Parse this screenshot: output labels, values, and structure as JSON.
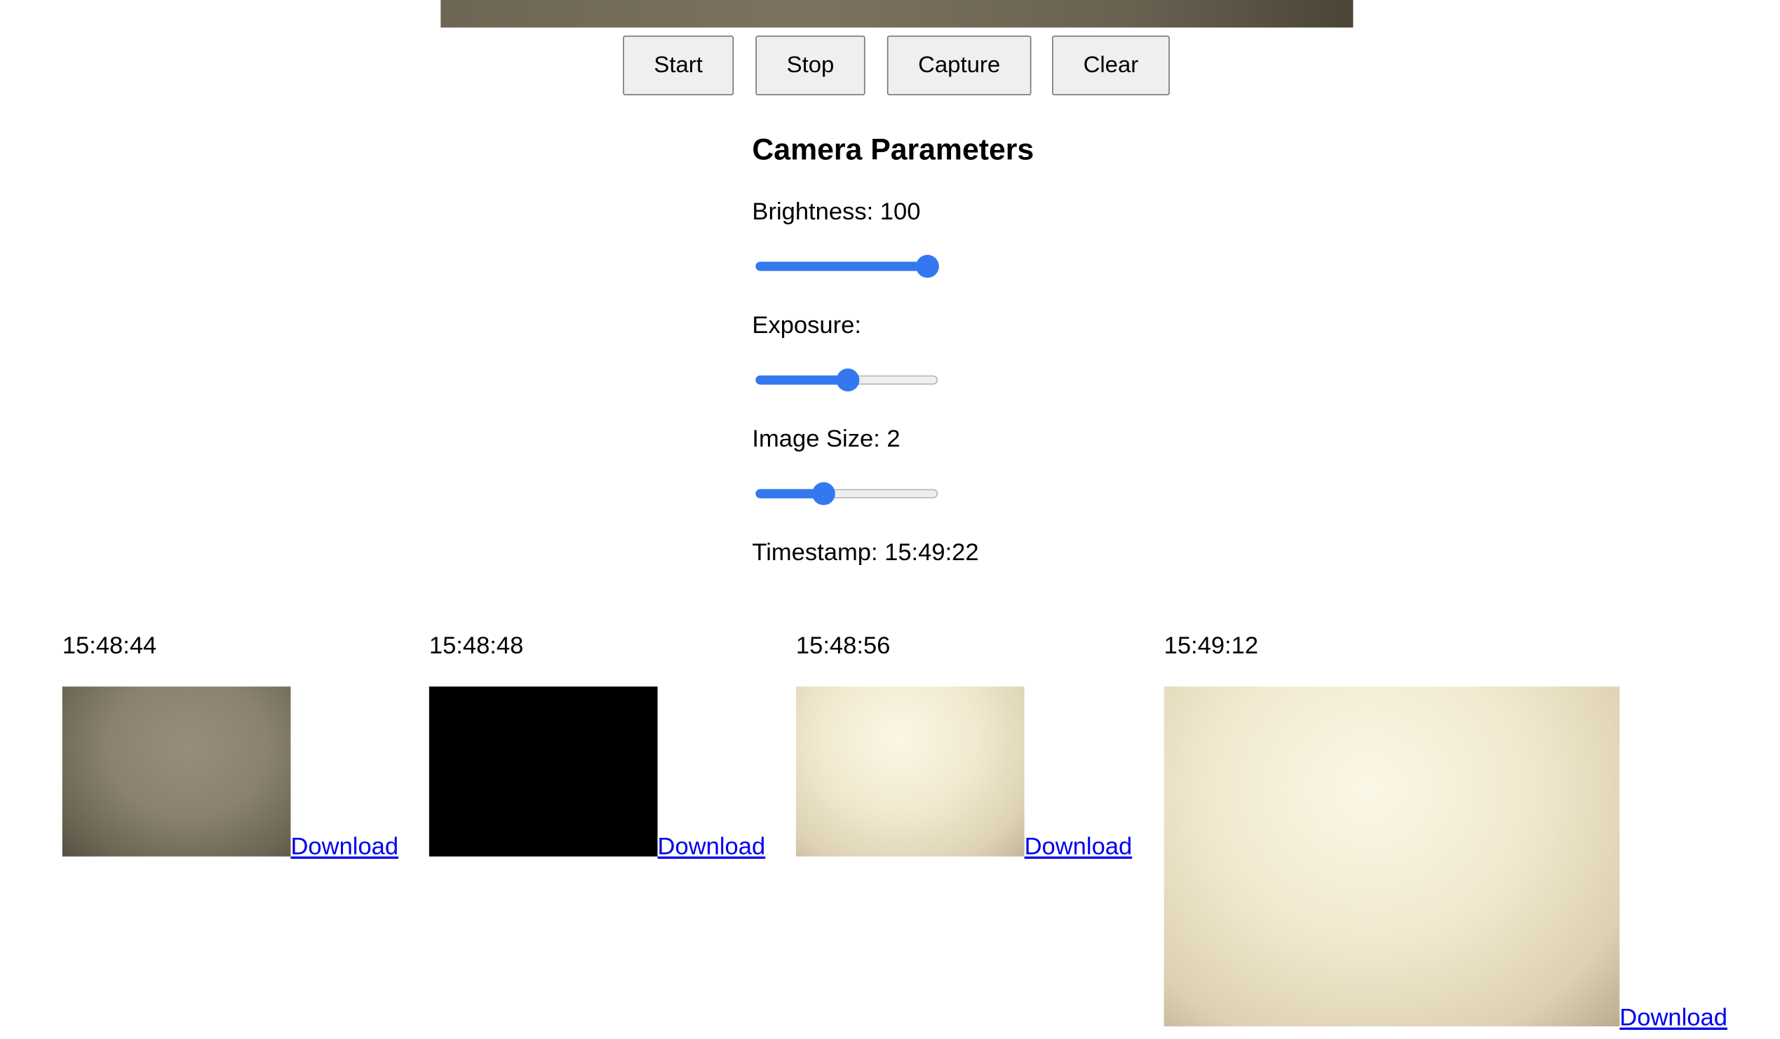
{
  "controls": {
    "start_label": "Start",
    "stop_label": "Stop",
    "capture_label": "Capture",
    "clear_label": "Clear"
  },
  "parameters": {
    "heading": "Camera Parameters",
    "brightness_label": "Brightness: 100",
    "brightness_level": 1.0,
    "exposure_label": "Exposure:",
    "exposure_level": 0.5,
    "image_size_label": "Image Size: 2",
    "image_size_level": 0.35,
    "timestamp_label": "Timestamp: 15:49:22",
    "accent_color": "#3478f0"
  },
  "captures": [
    {
      "timestamp": "15:48:44",
      "download_label": "Download",
      "tone": "dim-gray"
    },
    {
      "timestamp": "15:48:48",
      "download_label": "Download",
      "tone": "black"
    },
    {
      "timestamp": "15:48:56",
      "download_label": "Download",
      "tone": "bright-cream"
    },
    {
      "timestamp": "15:49:12",
      "download_label": "Download",
      "tone": "bright-cream"
    }
  ],
  "link_color": "#0000ee"
}
